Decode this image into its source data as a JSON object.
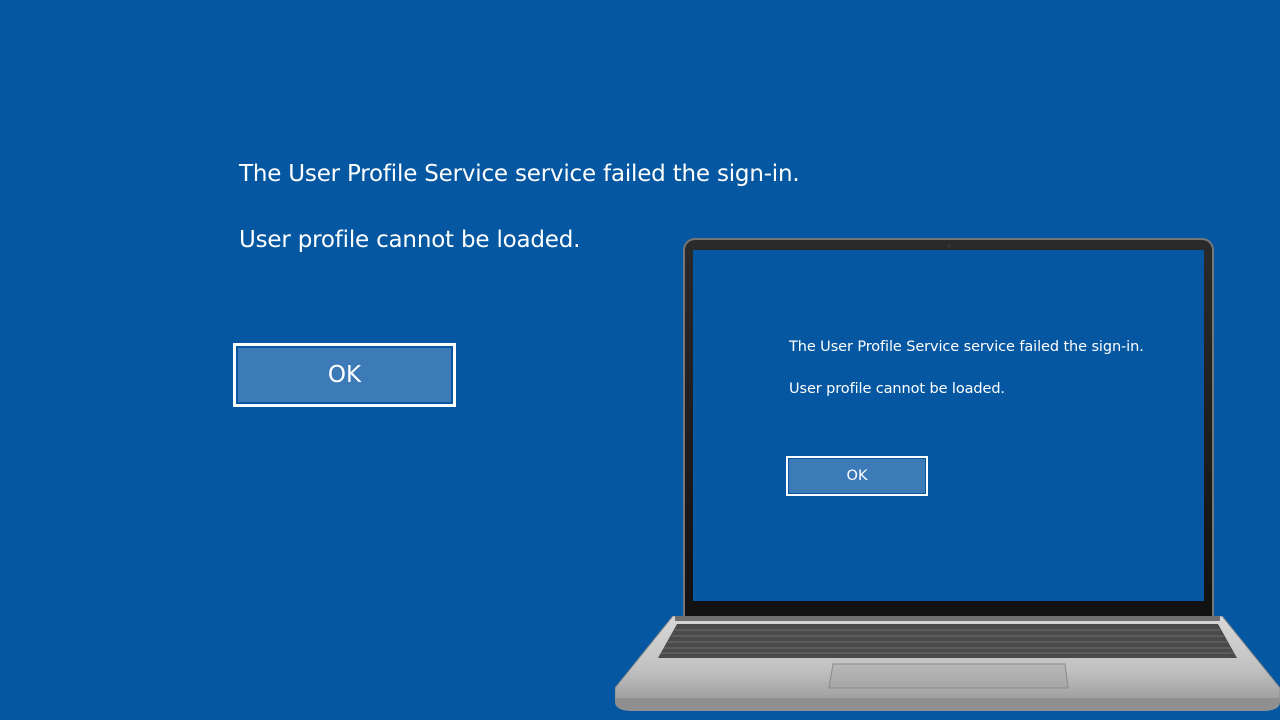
{
  "dialog": {
    "message_line1": "The User Profile Service service failed the sign-in.",
    "message_line2": "User profile cannot be loaded.",
    "ok_label": "OK"
  },
  "laptop_screen": {
    "message_line1": "The User Profile Service service failed the sign-in.",
    "message_line2": "User profile cannot be loaded.",
    "ok_label": "OK"
  },
  "colors": {
    "background": "#0457a0",
    "button_fill": "#3d7bb8",
    "text": "#ffffff"
  }
}
